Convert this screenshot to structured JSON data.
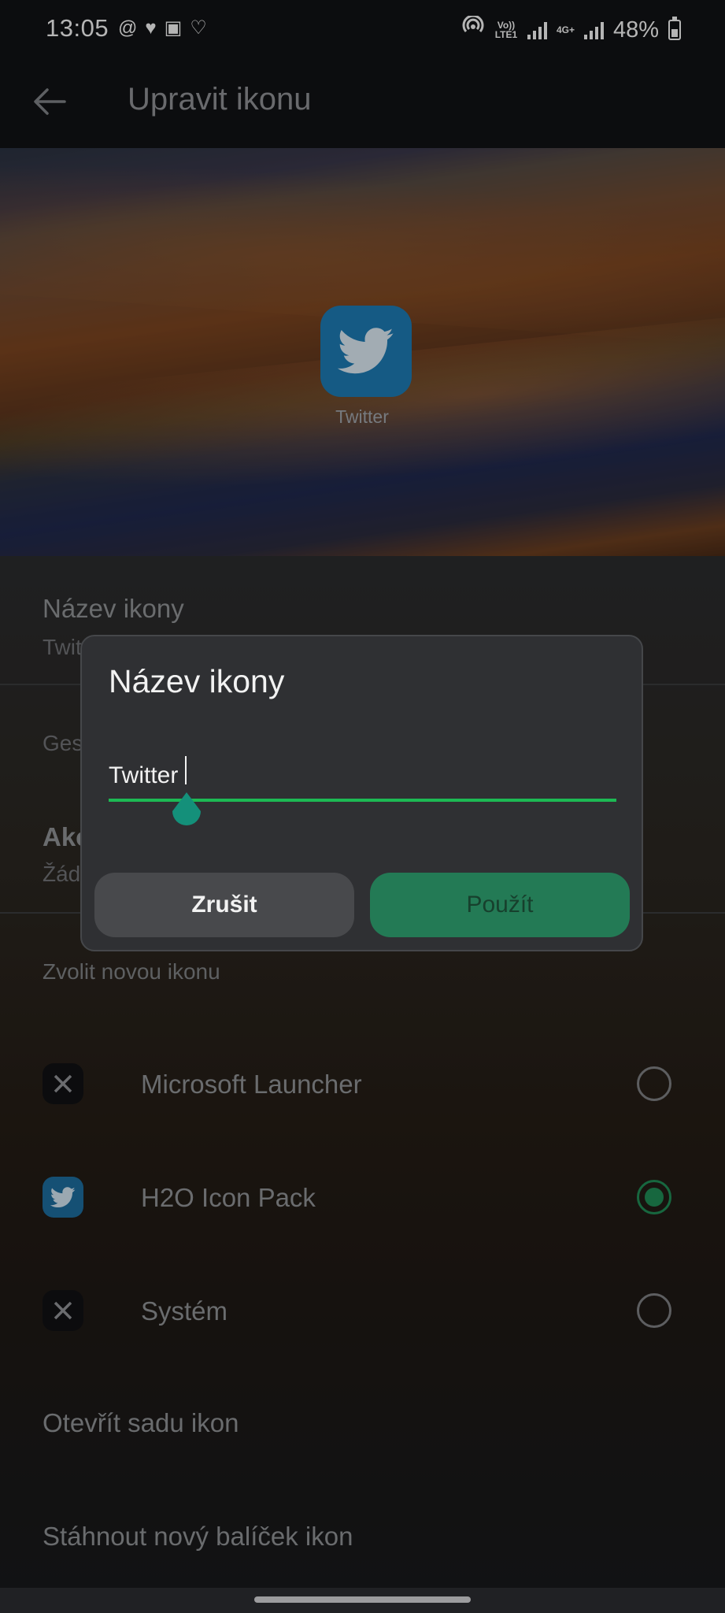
{
  "status_bar": {
    "time": "13:05",
    "battery": "48%",
    "volte_label": "Vo)) LTE1",
    "network_label": "4G+"
  },
  "app_bar": {
    "title": "Upravit ikonu"
  },
  "preview": {
    "icon_label": "Twitter",
    "icon_color": "#1c79b1"
  },
  "settings": {
    "icon_name": {
      "title": "Název ikony",
      "value": "Twitter"
    },
    "gestures": {
      "title": "Gesta"
    },
    "action": {
      "title": "Akce",
      "value": "Žádná"
    },
    "choose_icon_header": "Zvolit novou ikonu",
    "icon_packs": [
      {
        "label": "Microsoft Launcher",
        "icon": "x-logo-icon",
        "selected": false
      },
      {
        "label": "H2O Icon Pack",
        "icon": "twitter-bird-icon",
        "selected": true
      },
      {
        "label": "Systém",
        "icon": "x-logo-icon",
        "selected": false
      }
    ],
    "open_icon_pack": "Otevřít sadu ikon",
    "download_icon_pack": "Stáhnout nový balíček ikon"
  },
  "dialog": {
    "title": "Název ikony",
    "input_value": "Twitter",
    "cancel_label": "Zrušit",
    "apply_label": "Použít",
    "accent_color": "#1db954"
  }
}
